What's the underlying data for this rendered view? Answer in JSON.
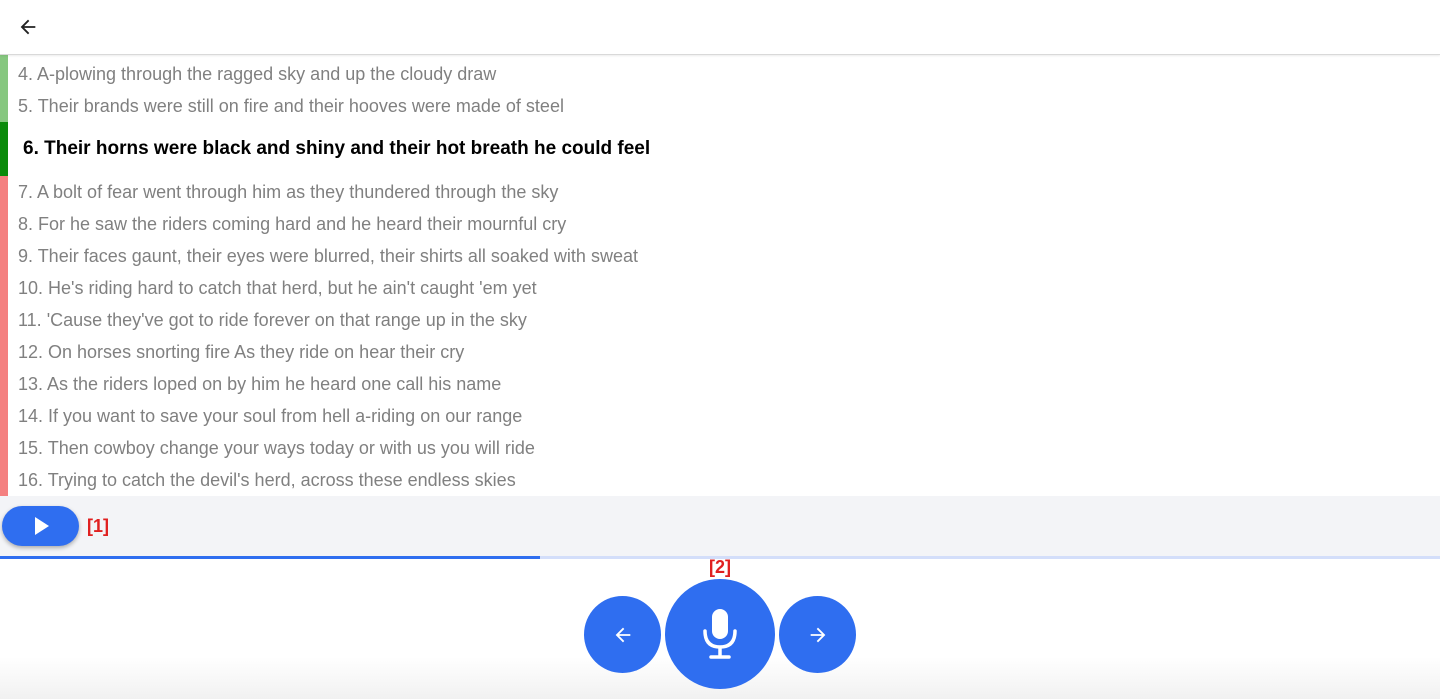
{
  "header": {
    "back_icon": "arrow-left-icon"
  },
  "colors": {
    "past_line_bar": "#86c77f",
    "current_line_bar": "#0a8a0a",
    "upcoming_line_bar": "#f48080",
    "accent": "#2f6ef0",
    "marker": "#e02020",
    "muted_text": "#808080",
    "progress_track": "#d3defa"
  },
  "lyrics": {
    "current_index": 2,
    "lines": [
      {
        "text": "4. A-plowing through the ragged sky and up the cloudy draw",
        "state": "past"
      },
      {
        "text": "5. Their brands were still on fire and their hooves were made of steel",
        "state": "past"
      },
      {
        "text": "6. Their horns were black and shiny and their hot breath he could feel",
        "state": "current"
      },
      {
        "text": "7. A bolt of fear went through him as they thundered through the sky",
        "state": "upcoming"
      },
      {
        "text": "8. For he saw the riders coming hard and he heard their mournful cry",
        "state": "upcoming"
      },
      {
        "text": "9. Their faces gaunt, their eyes were blurred, their shirts all soaked with sweat",
        "state": "upcoming"
      },
      {
        "text": "10. He's riding hard to catch that herd, but he ain't caught 'em yet",
        "state": "upcoming"
      },
      {
        "text": "11. 'Cause they've got to ride forever on that range up in the sky",
        "state": "upcoming"
      },
      {
        "text": "12. On horses snorting fire As they ride on hear their cry",
        "state": "upcoming"
      },
      {
        "text": "13. As the riders loped on by him he heard one call his name",
        "state": "upcoming"
      },
      {
        "text": "14. If you want to save your soul from hell a-riding on our range",
        "state": "upcoming"
      },
      {
        "text": "15. Then cowboy change your ways today or with us you will ride",
        "state": "upcoming"
      },
      {
        "text": "16. Trying to catch the devil's herd, across these endless skies",
        "state": "upcoming"
      }
    ]
  },
  "player": {
    "play_icon": "play-icon",
    "marker_label": "[1]",
    "progress_fraction": 0.375
  },
  "controls": {
    "prev_icon": "arrow-left-icon",
    "mic_icon": "microphone-icon",
    "next_icon": "arrow-right-icon",
    "mic_marker_label": "[2]"
  }
}
